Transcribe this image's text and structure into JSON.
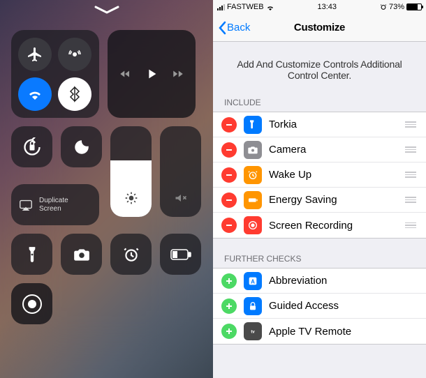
{
  "control_center": {
    "mirror_label": "Duplicate\nScreen",
    "brightness_fill": 62,
    "volume_fill": 0
  },
  "status": {
    "carrier": "FASTWEB",
    "time": "13:43",
    "battery_pct": "73%",
    "battery_fill": 73
  },
  "nav": {
    "back": "Back",
    "title": "Customize"
  },
  "desc": "Add And Customize Controls Additional Control Center.",
  "sections": {
    "include": "INCLUDE",
    "further": "FURTHER CHECKS"
  },
  "include": [
    {
      "label": "Torkia",
      "icon_bg": "#007aff",
      "icon": "flashlight"
    },
    {
      "label": "Camera",
      "icon_bg": "#8e8e93",
      "icon": "camera"
    },
    {
      "label": "Wake Up",
      "icon_bg": "#ff9500",
      "icon": "clock"
    },
    {
      "label": "Energy Saving",
      "icon_bg": "#ff9500",
      "icon": "battery"
    },
    {
      "label": "Screen Recording",
      "icon_bg": "#ff3b30",
      "icon": "record"
    }
  ],
  "further": [
    {
      "label": "Abbreviation",
      "icon_bg": "#007aff",
      "icon": "abbr"
    },
    {
      "label": "Guided Access",
      "icon_bg": "#007aff",
      "icon": "lock"
    },
    {
      "label": "Apple TV Remote",
      "icon_bg": "#4a4a4a",
      "icon": "tv"
    }
  ]
}
